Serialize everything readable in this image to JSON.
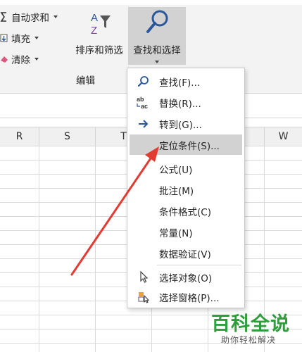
{
  "ribbon": {
    "autosum_label": "自动求和",
    "fill_label": "填充",
    "clear_label": "清除",
    "sort_filter_label": "排序和筛选",
    "find_select_label": "查找和选择",
    "group_label": "编辑"
  },
  "columns": [
    "R",
    "S",
    "T",
    "W"
  ],
  "menu": {
    "items": [
      {
        "label": "查找(F)...",
        "icon": "search-icon"
      },
      {
        "label": "替换(R)...",
        "icon": "replace-icon"
      },
      {
        "label": "转到(G)...",
        "icon": "arrow-right-icon"
      },
      {
        "label": "定位条件(S)...",
        "icon": ""
      },
      {
        "label": "公式(U)",
        "icon": ""
      },
      {
        "label": "批注(M)",
        "icon": ""
      },
      {
        "label": "条件格式(C)",
        "icon": ""
      },
      {
        "label": "常量(N)",
        "icon": ""
      },
      {
        "label": "数据验证(V)",
        "icon": ""
      },
      {
        "label": "选择对象(O)",
        "icon": "pointer-icon"
      },
      {
        "label": "选择窗格(P)...",
        "icon": "selection-pane-icon"
      }
    ]
  },
  "watermark": {
    "main": "百科全说",
    "sub": "助你轻松解决"
  },
  "colors": {
    "accent": "#2b579a",
    "highlight": "#d2d2d2",
    "annotation": "#e23b32",
    "watermark": "#2e9d3b"
  }
}
